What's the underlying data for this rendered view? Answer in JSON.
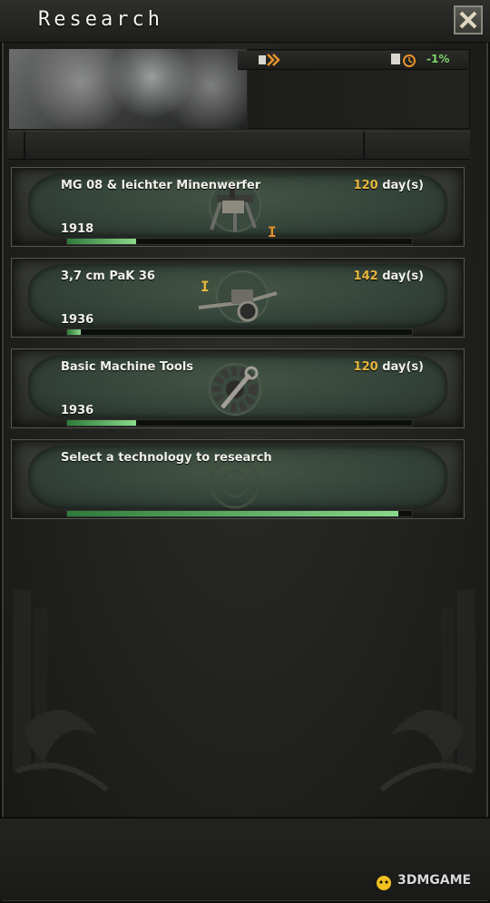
{
  "window": {
    "title": "Research"
  },
  "header": {
    "bonus_value": "-1%"
  },
  "slots": [
    {
      "name": "MG 08 & leichter Minenwerfer",
      "days": "120",
      "days_unit": "day(s)",
      "year": "1918",
      "progress": 0.2,
      "icon": "machine-gun-icon",
      "level_mark": "I"
    },
    {
      "name": "3,7 cm PaK 36",
      "days": "142",
      "days_unit": "day(s)",
      "year": "1936",
      "progress": 0.04,
      "icon": "anti-tank-gun-icon",
      "level_mark": "I"
    },
    {
      "name": "Basic Machine Tools",
      "days": "120",
      "days_unit": "day(s)",
      "year": "1936",
      "progress": 0.2,
      "icon": "machine-tools-icon"
    },
    {
      "name": "Select a technology to research",
      "progress": 0.96,
      "icon": "research-placeholder-icon"
    }
  ],
  "watermark": {
    "text": "3DMGAME"
  },
  "colors": {
    "accent_days": "#e7b73d",
    "bonus_green": "#7ed36a",
    "progress_green": "#2f7a3a"
  }
}
